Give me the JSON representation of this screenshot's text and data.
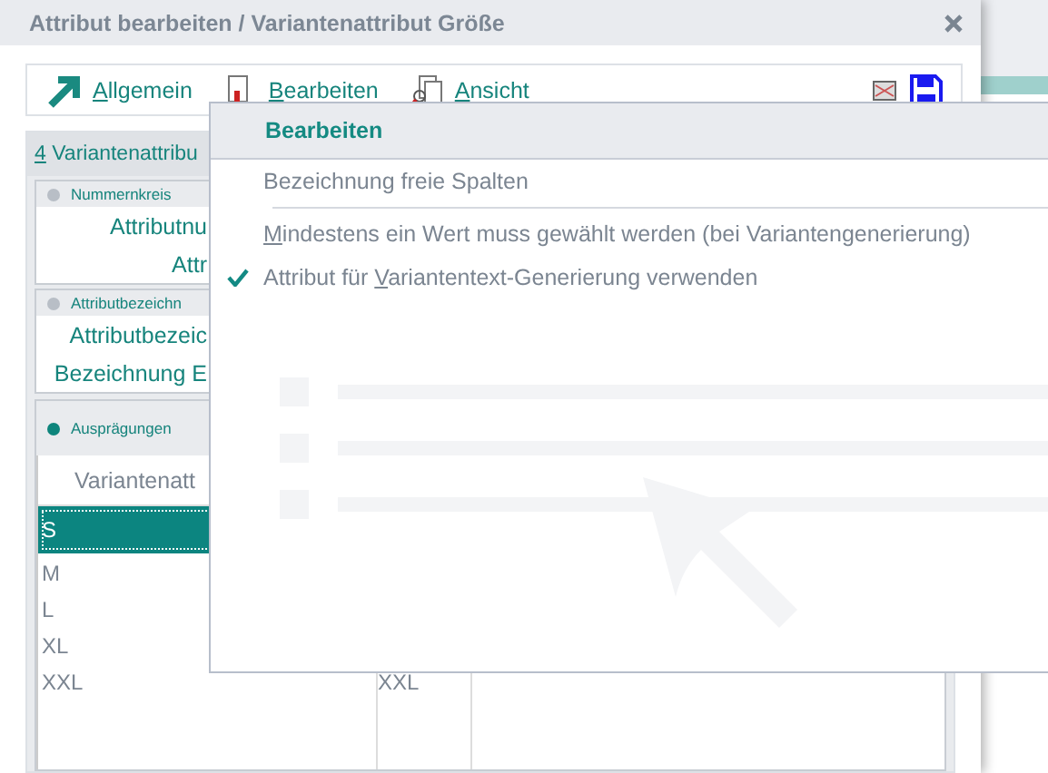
{
  "window": {
    "title": "Attribut bearbeiten / Variantenattribut Größe"
  },
  "toolbar": {
    "items": [
      {
        "kind": "arrow",
        "key": "A",
        "after": "llgemein"
      },
      {
        "kind": "edit",
        "key": "B",
        "after": "earbeiten"
      },
      {
        "kind": "view",
        "key": "A",
        "after": "nsicht"
      }
    ]
  },
  "panel": {
    "title": {
      "key": "4",
      "after": " Variantenattribu"
    },
    "sections": [
      {
        "title": "Nummernkreis",
        "active": false,
        "fields": [
          "Attributnu",
          "Attr"
        ]
      },
      {
        "title": "Attributbezeichn",
        "active": false,
        "fields": [
          "Attributbezeic",
          "Bezeichnung E"
        ]
      }
    ],
    "values_section": {
      "title": "Ausprägungen",
      "active": true,
      "table": {
        "columns": [
          "Variantenatt"
        ],
        "rows": [
          {
            "column_1": "S",
            "selected": true
          },
          {
            "column_1": "M",
            "selected": false
          },
          {
            "column_1": "L",
            "selected": false
          },
          {
            "column_1": "XL",
            "selected": false
          },
          {
            "column_1": "XXL",
            "column_2": "XXL",
            "selected": false
          }
        ]
      }
    }
  },
  "menu": {
    "title": "Bearbeiten",
    "items": [
      {
        "before": "Bezeichnung freie Spalten",
        "checked": false,
        "separator_after": true
      },
      {
        "key": "M",
        "after": "indestens ein Wert muss gewählt werden (bei Variantengenerierung)",
        "checked": false,
        "separator_after": false
      },
      {
        "before": "Attribut für ",
        "key": "V",
        "after": "ariantentext-Generierung verwenden",
        "checked": true,
        "separator_after": false
      }
    ]
  }
}
